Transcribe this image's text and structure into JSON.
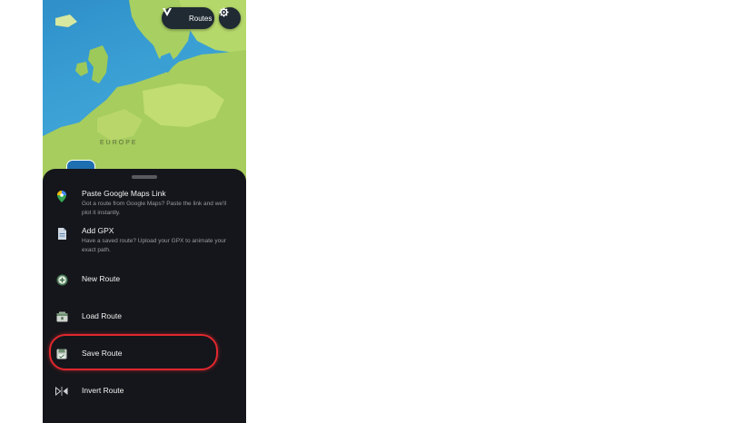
{
  "header": {
    "routes_label": "Routes"
  },
  "map": {
    "region_label": "EUROPE"
  },
  "menu": {
    "items": [
      {
        "title": "Paste Google Maps Link",
        "description": "Got a route from Google Maps? Paste the link and we'll plot it instantly.",
        "icon": "map-pin-icon"
      },
      {
        "title": "Add GPX",
        "description": "Have a saved route? Upload your GPX to animate your exact path.",
        "icon": "file-icon"
      },
      {
        "title": "New Route",
        "icon": "add-icon"
      },
      {
        "title": "Load Route",
        "icon": "folder-icon"
      },
      {
        "title": "Save Route",
        "icon": "save-icon"
      },
      {
        "title": "Invert Route",
        "icon": "invert-icon"
      }
    ],
    "highlighted_item": "Save Route"
  },
  "colors": {
    "sheet_background": "#15161b",
    "highlight_ring": "#e0282e",
    "map_water": "#3aa0d4",
    "map_land": "#9cc95a"
  }
}
